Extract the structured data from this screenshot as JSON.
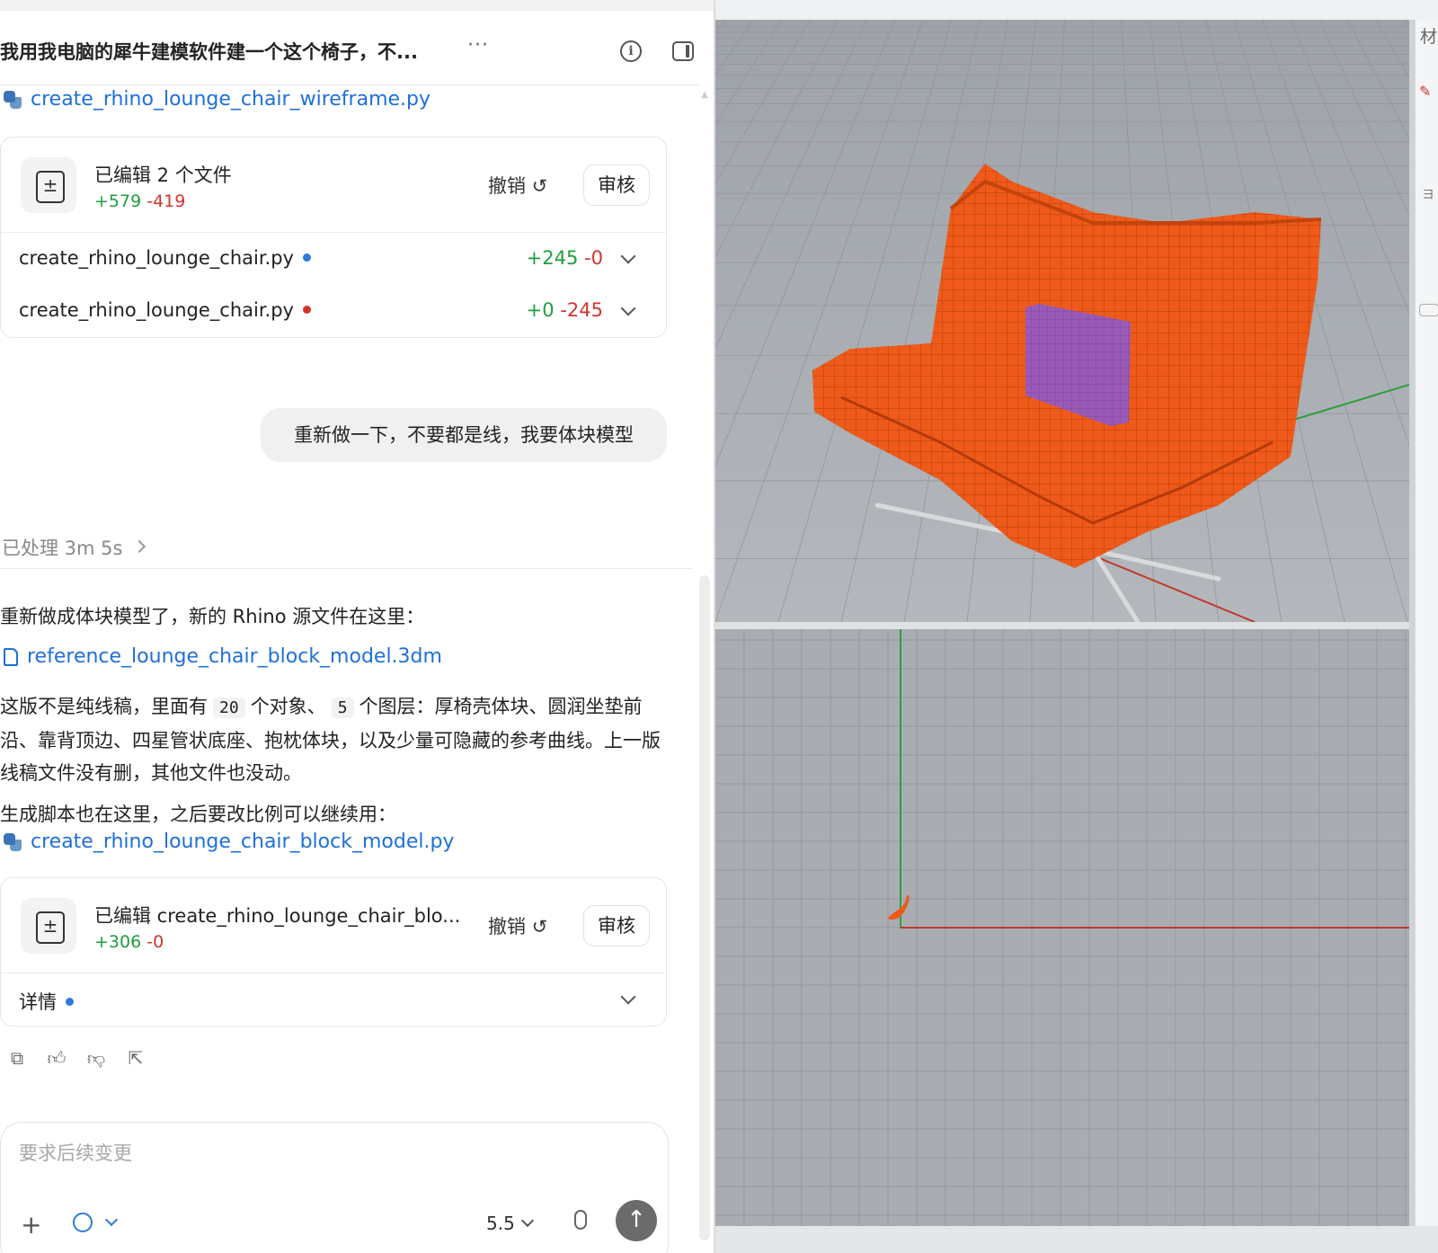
{
  "chat": {
    "title": "我用我电脑的犀牛建模软件建一个这个椅子，不...",
    "more_label": "···",
    "info_label": "i",
    "top_file_link": "create_rhino_lounge_chair_wireframe.py",
    "edit_card_1": {
      "title": "已编辑 2 个文件",
      "added": "+579",
      "removed": "-419",
      "undo_label": "撤销 ↺",
      "review_label": "审核",
      "files": [
        {
          "name": "create_rhino_lounge_chair.py",
          "added": "+245",
          "removed": "-0",
          "dot_color": "#2e7bd8"
        },
        {
          "name": "create_rhino_lounge_chair.py",
          "added": "+0",
          "removed": "-245",
          "dot_color": "#d4342d"
        }
      ]
    },
    "user_message": "重新做一下，不要都是线，我要体块模型",
    "processed_label": "已处理 3m 5s",
    "reply": {
      "intro": "重新做成体块模型了，新的 Rhino 源文件在这里：",
      "model_file": "reference_lounge_chair_block_model.3dm",
      "desc_part1": "这版不是纯线稿，里面有",
      "object_count": "20",
      "desc_part2": "个对象、",
      "layer_count": "5",
      "desc_part3": "个图层：厚椅壳体块、圆润坐垫前沿、靠背顶边、四星管状底座、抱枕体块，以及少量可隐藏的参考曲线。上一版线稿文件没有删，其他文件也没动。",
      "script_intro": "生成脚本也在这里，之后要改比例可以继续用：",
      "script_file": "create_rhino_lounge_chair_block_model.py"
    },
    "edit_card_2": {
      "title": "已编辑 create_rhino_lounge_chair_blo...",
      "added": "+306",
      "removed": "-0",
      "undo_label": "撤销 ↺",
      "review_label": "审核",
      "details_label": "详情",
      "details_dot_color": "#2e7bd8"
    },
    "actions": [
      "copy-icon",
      "thumbs-up-icon",
      "thumbs-down-icon",
      "share-icon"
    ],
    "composer": {
      "placeholder": "要求后续变更",
      "add_label": "+",
      "model_label": "5.5",
      "send_label": "↑"
    }
  },
  "rhino": {
    "dock_label": "材",
    "dock_text": "ヨ",
    "colors": {
      "viewport_bg": "#a9adb2",
      "grid_line": "#8f9399",
      "chair_orange": "#ef5a1a",
      "chair_wire": "#b33a08",
      "pillow_purple": "#9a5ab8",
      "x_axis": "#c0392b",
      "y_axis": "#2e9e3e"
    }
  }
}
